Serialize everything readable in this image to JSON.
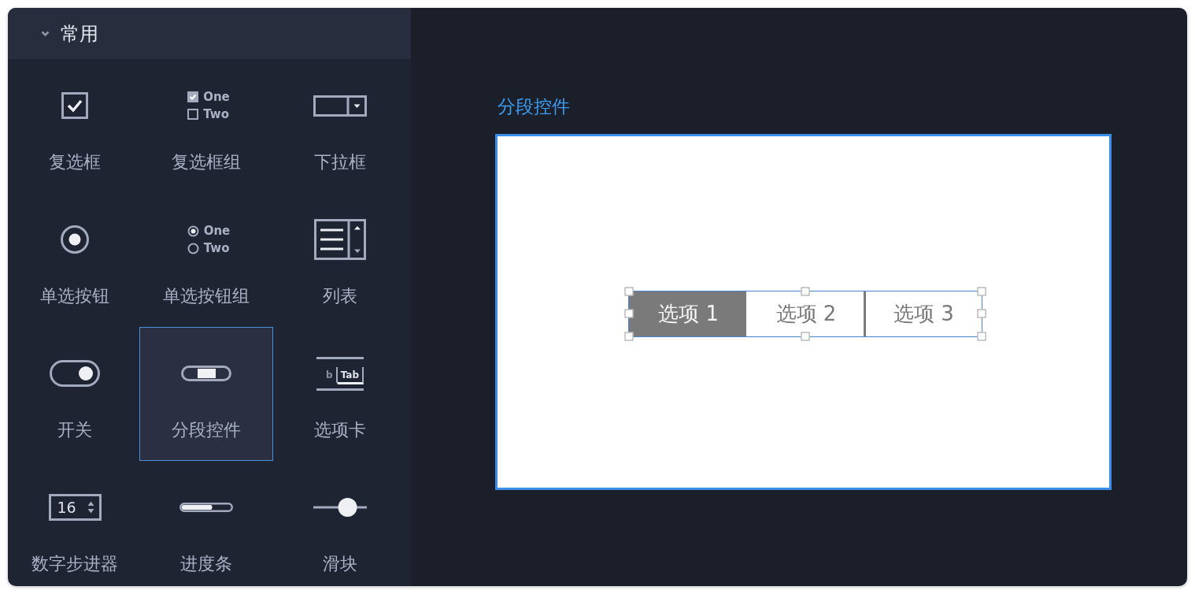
{
  "palette": {
    "header": {
      "title": "常用",
      "expanded": true
    },
    "items": [
      {
        "kind": "checkbox",
        "label": "复选框",
        "checked": true,
        "selected": false
      },
      {
        "kind": "checkbox-group",
        "label": "复选框组",
        "options": [
          {
            "label": "One",
            "checked": true
          },
          {
            "label": "Two",
            "checked": false
          }
        ],
        "selected": false
      },
      {
        "kind": "dropdown",
        "label": "下拉框",
        "selected": false
      },
      {
        "kind": "radio",
        "label": "单选按钮",
        "checked": true,
        "selected": false
      },
      {
        "kind": "radio-group",
        "label": "单选按钮组",
        "options": [
          {
            "label": "One",
            "selected": true
          },
          {
            "label": "Two",
            "selected": false
          }
        ],
        "selected": false
      },
      {
        "kind": "list",
        "label": "列表",
        "selected": false
      },
      {
        "kind": "switch",
        "label": "开关",
        "on": true,
        "selected": false
      },
      {
        "kind": "segmented",
        "label": "分段控件",
        "selected": true
      },
      {
        "kind": "tabs",
        "label": "选项卡",
        "tabs": [
          {
            "label": "b",
            "selected": false
          },
          {
            "label": "Tab",
            "selected": true
          }
        ],
        "selected": false
      },
      {
        "kind": "stepper",
        "label": "数字步进器",
        "value": "16",
        "selected": false
      },
      {
        "kind": "progress",
        "label": "进度条",
        "level": 0.62,
        "selected": false
      },
      {
        "kind": "slider",
        "label": "滑块",
        "level": 0.64,
        "selected": false
      }
    ]
  },
  "canvas": {
    "title": "分段控件",
    "segments": [
      {
        "label": "选项 1",
        "selected": true
      },
      {
        "label": "选项 2",
        "selected": false
      },
      {
        "label": "选项 3",
        "selected": false
      }
    ]
  }
}
